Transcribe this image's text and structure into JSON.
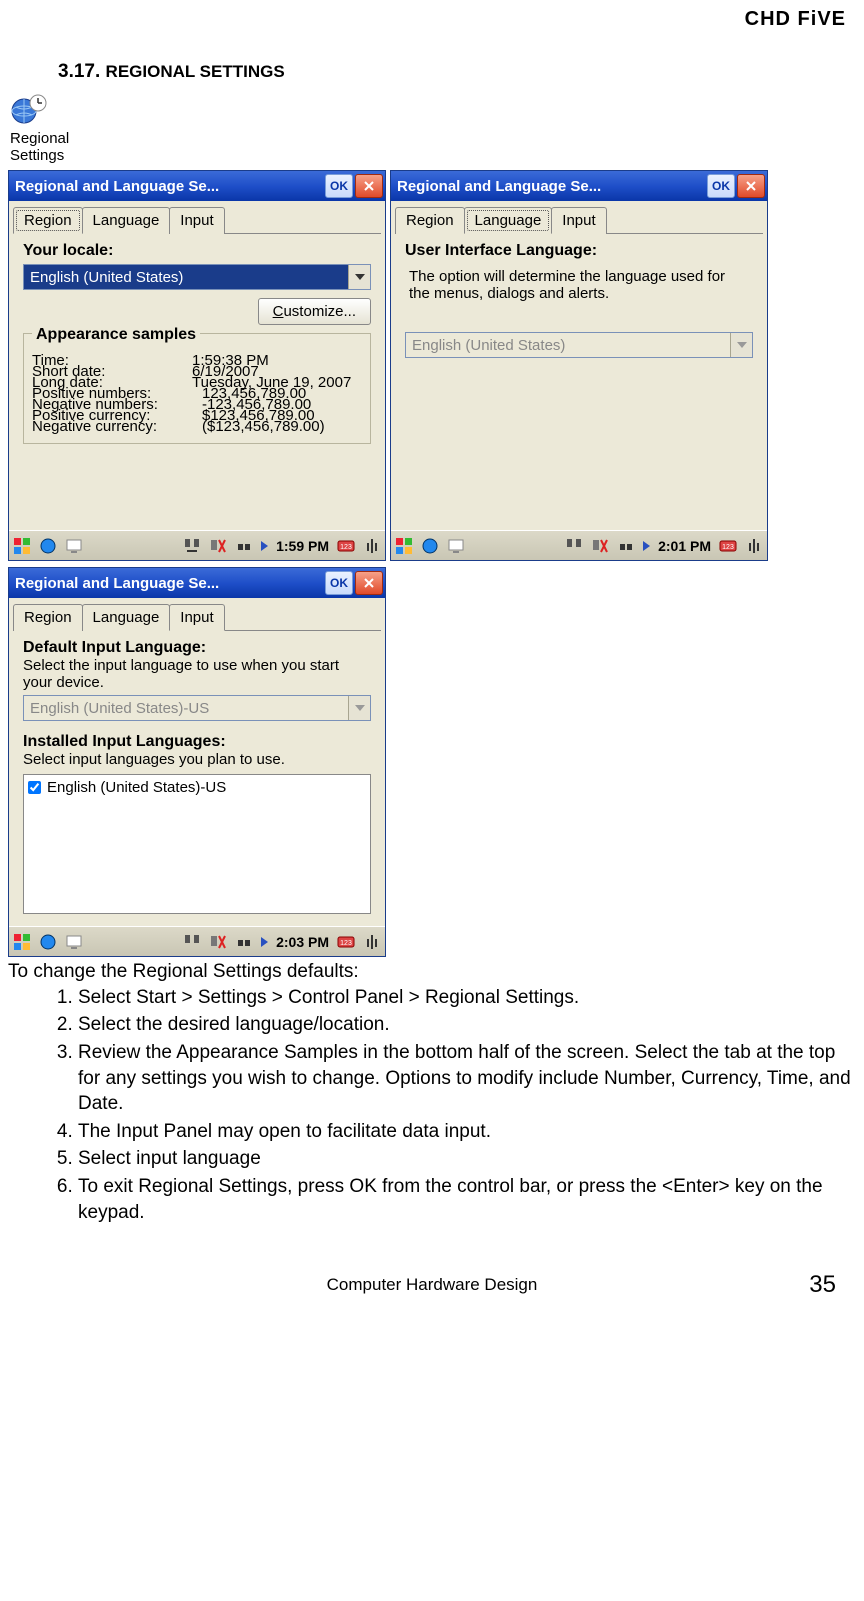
{
  "header": {
    "brand": "CHD FiVE"
  },
  "section": {
    "number": "3.17.",
    "title": "REGIONAL SETTINGS"
  },
  "icon_label": "Regional\nSettings",
  "win1": {
    "title": "Regional and Language Se...",
    "ok": "OK",
    "tabs": [
      "Region",
      "Language",
      "Input"
    ],
    "locale_label": "Your locale:",
    "locale_value": "English (United States)",
    "customize": "Customize...",
    "fieldset": "Appearance samples",
    "rows": [
      {
        "l": "Time:",
        "v": "1:59:38 PM"
      },
      {
        "l": "Short date:",
        "v": "6/19/2007"
      },
      {
        "l": "Long date:",
        "v": "Tuesday, June 19, 2007"
      },
      {
        "l": "Positive numbers:",
        "v": "123,456,789.00"
      },
      {
        "l": "Negative numbers:",
        "v": "-123,456,789.00"
      },
      {
        "l": "Positive currency:",
        "v": "$123,456,789.00"
      },
      {
        "l": "Negative currency:",
        "v": "($123,456,789.00)"
      }
    ],
    "taskbar_time": "1:59 PM"
  },
  "win2": {
    "title": "Regional and Language Se...",
    "ok": "OK",
    "tabs": [
      "Region",
      "Language",
      "Input"
    ],
    "heading": "User Interface Language:",
    "text": "The option will determine the language used for the menus, dialogs and alerts.",
    "combo": "English (United States)",
    "taskbar_time": "2:01 PM"
  },
  "win3": {
    "title": "Regional and Language Se...",
    "ok": "OK",
    "tabs": [
      "Region",
      "Language",
      "Input"
    ],
    "h1": "Default Input Language:",
    "t1": "Select the input language to use when you start your device.",
    "combo": "English (United States)-US",
    "h2": "Installed Input Languages:",
    "t2": "Select input languages you plan to use.",
    "item": "English (United States)-US",
    "taskbar_time": "2:03 PM"
  },
  "instr": {
    "intro": "To change the Regional Settings defaults:",
    "items": [
      "Select Start > Settings > Control Panel > Regional Settings.",
      "Select the desired language/location.",
      "Review the Appearance Samples in the bottom half of the screen. Select the tab at the top for any settings you wish to change. Options to modify include Number, Currency, Time, and Date.",
      "The Input Panel may open to facilitate data input.",
      "Select input language",
      "To exit Regional Settings, press OK from the control bar, or press the <Enter> key on the keypad."
    ]
  },
  "footer": {
    "center": "Computer Hardware Design",
    "page": "35"
  }
}
